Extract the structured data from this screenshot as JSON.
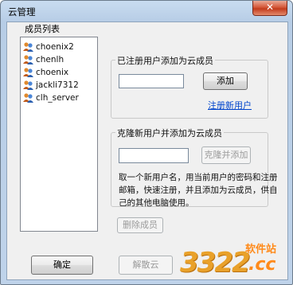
{
  "window": {
    "title": "云管理",
    "close_glyph": "✕"
  },
  "members": {
    "label": "成员列表",
    "items": [
      "choenix2",
      "chenlh",
      "choenix",
      "jackli7312",
      "clh_server"
    ]
  },
  "register_group": {
    "title": "已注册用户添加为云成员",
    "input_value": "",
    "add_button": "添加",
    "register_link": "注册新用户"
  },
  "clone_group": {
    "title": "克隆新用户并添加为云成员",
    "input_value": "",
    "clone_button": "克隆并添加",
    "description": "取一个新用户名，用当前用户的密码和注册邮箱，快速注册，并且添加为云成员，供自己的其他电脑使用。"
  },
  "footer": {
    "delete_button": "删除成员",
    "ok_button": "确定",
    "dissolve_button": "解散云"
  },
  "watermark": {
    "logo": "3322",
    "site_cn": "软件站",
    "site_en": ".cc"
  },
  "colors": {
    "accent": "#0044cc",
    "title_bar": "#b7cde6",
    "close": "#c23b1c",
    "watermark": "#ff8a1a"
  }
}
